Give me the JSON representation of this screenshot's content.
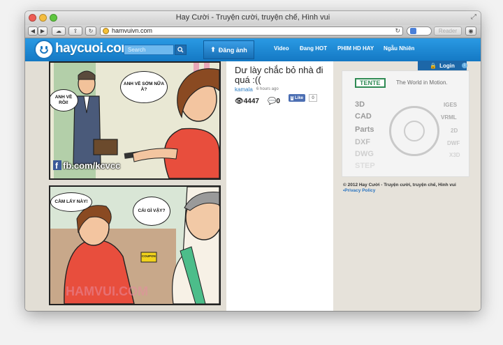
{
  "window": {
    "title": "Hay Cười - Truyện cười, truyện chế, Hình vui"
  },
  "browser": {
    "url": "hamvuivn.com",
    "reader_label": "Reader"
  },
  "site": {
    "logo_text": "haycuoi.com",
    "search_placeholder": "Search",
    "post_button_label": "Đăng ảnh",
    "nav": [
      "Video",
      "Đang HOT",
      "PHIM HD HAY",
      "Ngẫu Nhiên"
    ],
    "login_label": "Login"
  },
  "comic": {
    "bubble1": "ANH VỀ RỒI!",
    "bubble2": "ANH VỀ SỚM NỮA À?",
    "fb_label": "fb.com/kcvcc",
    "bubble3": "CẦM LẤY NÀY!",
    "bubble4": "CÁI GÌ VẬY?",
    "coupon_label": "COUPON",
    "watermark": "HAMVUI.COM"
  },
  "post": {
    "title": "Dư lày chắc bỏ nhà đi quá :((",
    "author": "kamala",
    "time": "6 hours ago",
    "views": "4447",
    "comments": "0",
    "like_label": "Like",
    "like_count": "0"
  },
  "ad": {
    "brand": "TENTE",
    "tagline": "The World in Motion.",
    "left_words": [
      "3D",
      "CAD",
      "Parts",
      "DXF",
      "DWG",
      "STEP"
    ],
    "right_words": [
      "IGES",
      "VRML",
      "2D",
      "DWF",
      "X3D"
    ]
  },
  "footer": {
    "copyright": "© 2012 Hay Cười - Truyện cười, truyện chế, Hình vui",
    "privacy": "•Privacy Policy"
  },
  "colors": {
    "header_blue": "#1b86d6",
    "like_blue": "#4c6fb3",
    "link_blue": "#2a74c0"
  }
}
